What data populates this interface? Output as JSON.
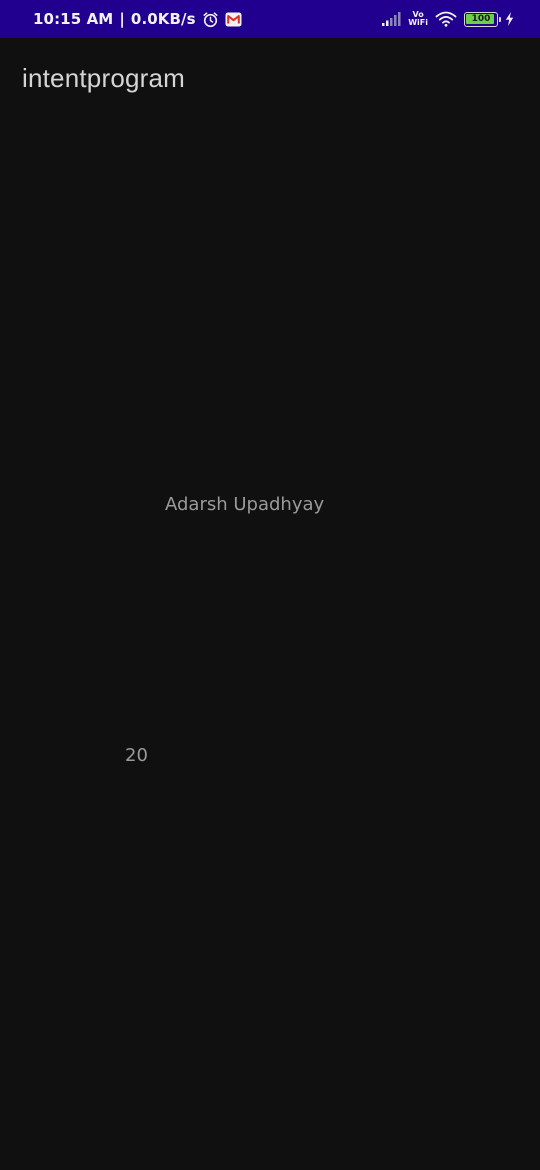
{
  "status_bar": {
    "time": "10:15 AM",
    "separator": "|",
    "network_speed": "0.0KB/s",
    "vowifi_top": "Vo",
    "vowifi_bottom": "WiFi",
    "battery_level": "100",
    "battery_fraction": 1,
    "icons": {
      "alarm": "alarm-clock-icon",
      "gmail": "gmail-icon",
      "signal": "signal-icon",
      "wifi": "wifi-icon",
      "charging": "charging-bolt-icon"
    },
    "colors": {
      "background": "#21008f",
      "battery_fill": "#6bd14c",
      "gmail_red": "#d93025"
    }
  },
  "app_bar": {
    "title": "intentprogram"
  },
  "content": {
    "name": "Adarsh Upadhyay",
    "age": "20"
  },
  "colors": {
    "background": "#101010",
    "title_text": "#d5d5d5",
    "body_text": "#9a9a9a"
  }
}
